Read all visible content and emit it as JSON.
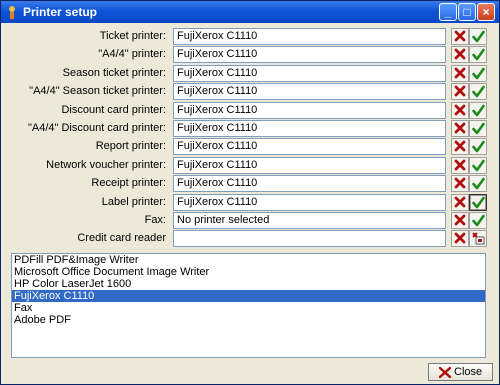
{
  "window": {
    "title": "Printer setup"
  },
  "rows": [
    {
      "label": "Ticket printer:",
      "value": "FujiXerox C1110",
      "ok_icon": "check-icon"
    },
    {
      "label": "\"A4/4\" printer:",
      "value": "FujiXerox C1110",
      "ok_icon": "check-icon"
    },
    {
      "label": "Season ticket printer:",
      "value": "FujiXerox C1110",
      "ok_icon": "check-icon"
    },
    {
      "label": "\"A4/4\" Season ticket printer:",
      "value": "FujiXerox C1110",
      "ok_icon": "check-icon"
    },
    {
      "label": "Discount card printer:",
      "value": "FujiXerox C1110",
      "ok_icon": "check-icon"
    },
    {
      "label": "\"A4/4\" Discount card printer:",
      "value": "FujiXerox C1110",
      "ok_icon": "check-icon"
    },
    {
      "label": "Report printer:",
      "value": "FujiXerox C1110",
      "ok_icon": "check-icon"
    },
    {
      "label": "Network voucher printer:",
      "value": "FujiXerox C1110",
      "ok_icon": "check-icon"
    },
    {
      "label": "Receipt printer:",
      "value": "FujiXerox C1110",
      "ok_icon": "check-icon"
    },
    {
      "label": "Label printer:",
      "value": "FujiXerox C1110",
      "ok_icon": "check-icon",
      "selected": true
    },
    {
      "label": "Fax:",
      "value": "No printer selected",
      "ok_icon": "check-icon"
    },
    {
      "label": "Credit card reader",
      "value": "",
      "ok_icon": "card-reader-icon"
    }
  ],
  "printer_list": [
    {
      "name": "PDFill PDF&Image Writer"
    },
    {
      "name": "Microsoft Office Document Image Writer"
    },
    {
      "name": "HP Color LaserJet 1600"
    },
    {
      "name": "FujiXerox C1110",
      "selected": true
    },
    {
      "name": "Fax"
    },
    {
      "name": "Adobe PDF"
    }
  ],
  "footer": {
    "close_label": "Close"
  },
  "colors": {
    "title_bar": "#0e55d8",
    "selection": "#316ac5",
    "remove": "#b01010",
    "confirm": "#1e8a1e"
  }
}
